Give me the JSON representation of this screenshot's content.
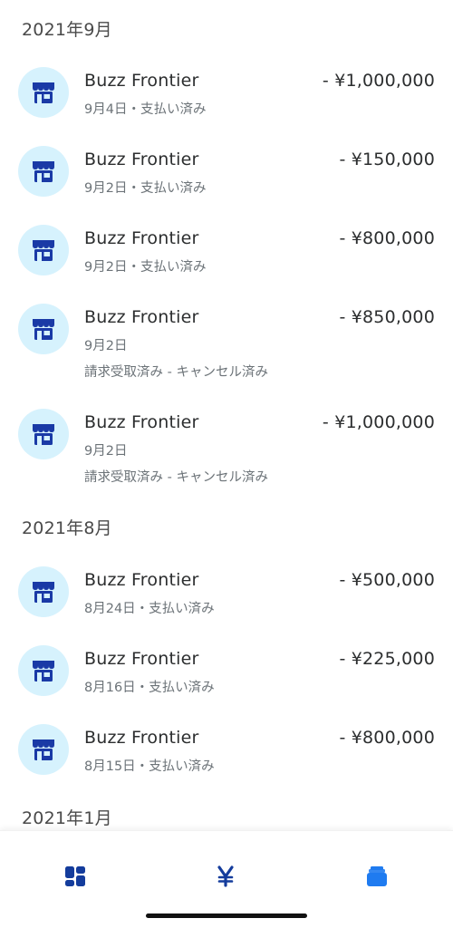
{
  "colors": {
    "avatar_bg": "#d6f2fd",
    "store_icon": "#1a3aa6",
    "tab_inactive": "#143c9c",
    "tab_active": "#1f7bf0"
  },
  "sections": [
    {
      "header": "2021年9月",
      "transactions": [
        {
          "merchant": "Buzz Frontier",
          "amount": "- ¥1,000,000",
          "line1": "9月4日・支払い済み",
          "line2": "",
          "icon": "store-icon"
        },
        {
          "merchant": "Buzz Frontier",
          "amount": "- ¥150,000",
          "line1": "9月2日・支払い済み",
          "line2": "",
          "icon": "store-icon"
        },
        {
          "merchant": "Buzz Frontier",
          "amount": "- ¥800,000",
          "line1": "9月2日・支払い済み",
          "line2": "",
          "icon": "store-icon"
        },
        {
          "merchant": "Buzz Frontier",
          "amount": "- ¥850,000",
          "line1": "9月2日",
          "line2": "請求受取済み - キャンセル済み",
          "icon": "store-icon"
        },
        {
          "merchant": "Buzz Frontier",
          "amount": "- ¥1,000,000",
          "line1": "9月2日",
          "line2": "請求受取済み - キャンセル済み",
          "icon": "store-icon"
        }
      ]
    },
    {
      "header": "2021年8月",
      "transactions": [
        {
          "merchant": "Buzz Frontier",
          "amount": "- ¥500,000",
          "line1": "8月24日・支払い済み",
          "line2": "",
          "icon": "store-icon"
        },
        {
          "merchant": "Buzz Frontier",
          "amount": "- ¥225,000",
          "line1": "8月16日・支払い済み",
          "line2": "",
          "icon": "store-icon"
        },
        {
          "merchant": "Buzz Frontier",
          "amount": "- ¥800,000",
          "line1": "8月15日・支払い済み",
          "line2": "",
          "icon": "store-icon"
        }
      ]
    },
    {
      "header": "2021年1月",
      "transactions": []
    }
  ],
  "tabbar": {
    "tabs": [
      {
        "icon": "dashboard-icon",
        "active": false
      },
      {
        "icon": "yen-icon",
        "active": false
      },
      {
        "icon": "wallet-cards-icon",
        "active": true
      }
    ]
  }
}
